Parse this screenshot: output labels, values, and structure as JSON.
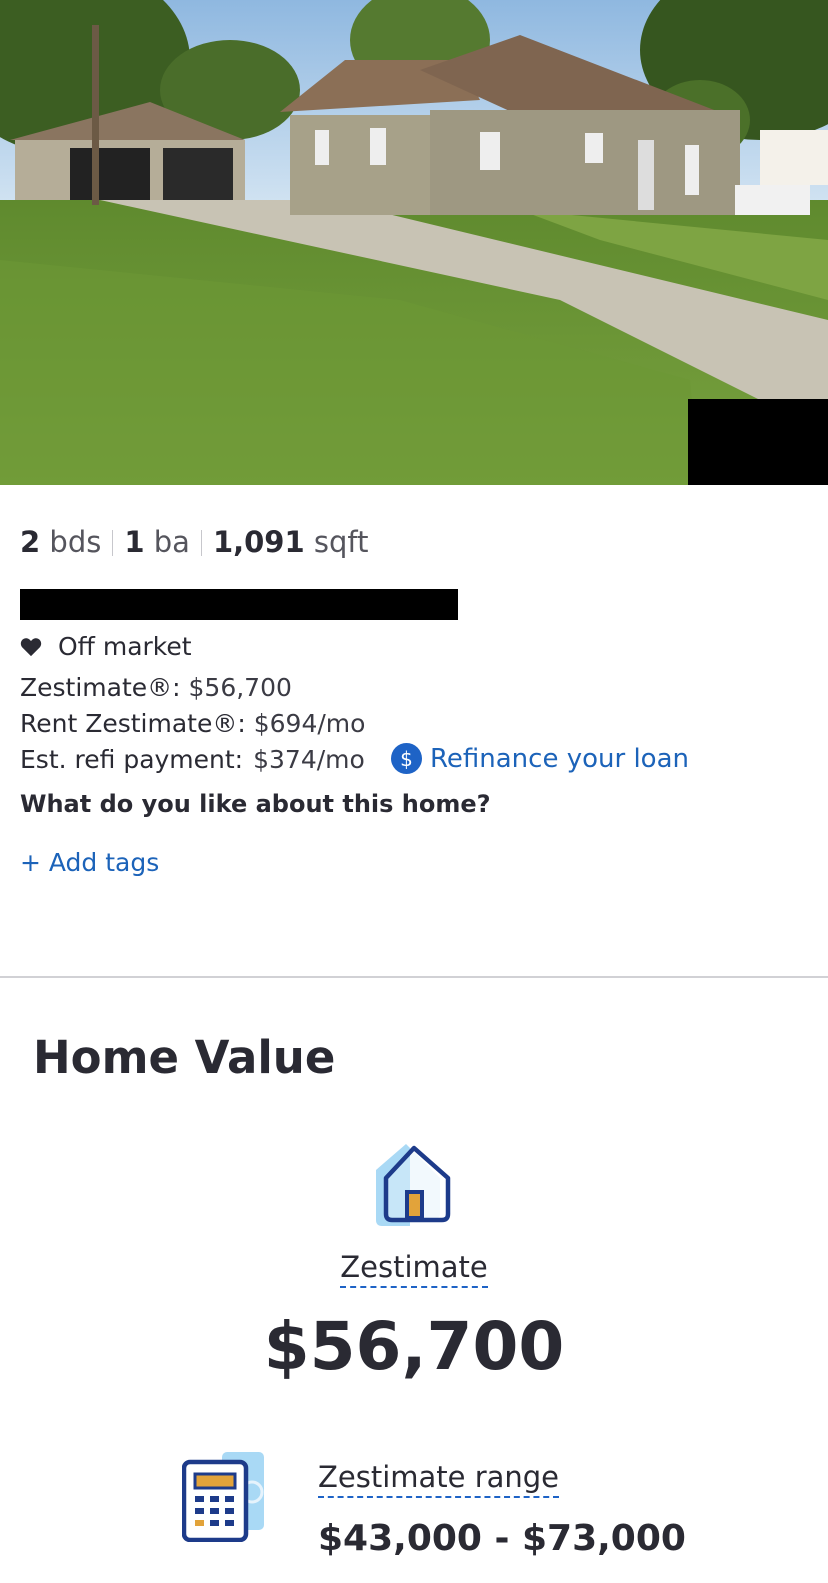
{
  "listing": {
    "photo_alt": "property-photo",
    "facts": {
      "beds_value": "2",
      "beds_unit": "bds",
      "baths_value": "1",
      "baths_unit": "ba",
      "sqft_value": "1,091",
      "sqft_unit": "sqft"
    },
    "status": {
      "icon": "heart-icon",
      "label": "Off market"
    },
    "zestimate": {
      "label": "Zestimate®:",
      "value": "$56,700"
    },
    "rent_zestimate": {
      "label": "Rent Zestimate®:",
      "value": "$694/mo"
    },
    "refi": {
      "label": "Est. refi payment:",
      "value": "$374/mo",
      "link_icon_glyph": "$",
      "link_label": "Refinance your loan"
    },
    "question": "What do you like about this home?",
    "add_tags": "+ Add tags"
  },
  "home_value": {
    "title": "Home Value",
    "zestimate_label": "Zestimate",
    "zestimate_value": "$56,700",
    "range_label": "Zestimate range",
    "range_value": "$43,000 - $73,000"
  },
  "colors": {
    "link_blue": "#1c63b9",
    "text_dark": "#2a2a33",
    "icon_light_blue": "#a9d9f5",
    "icon_navy": "#1d3b8a",
    "icon_orange": "#e2a33a"
  }
}
